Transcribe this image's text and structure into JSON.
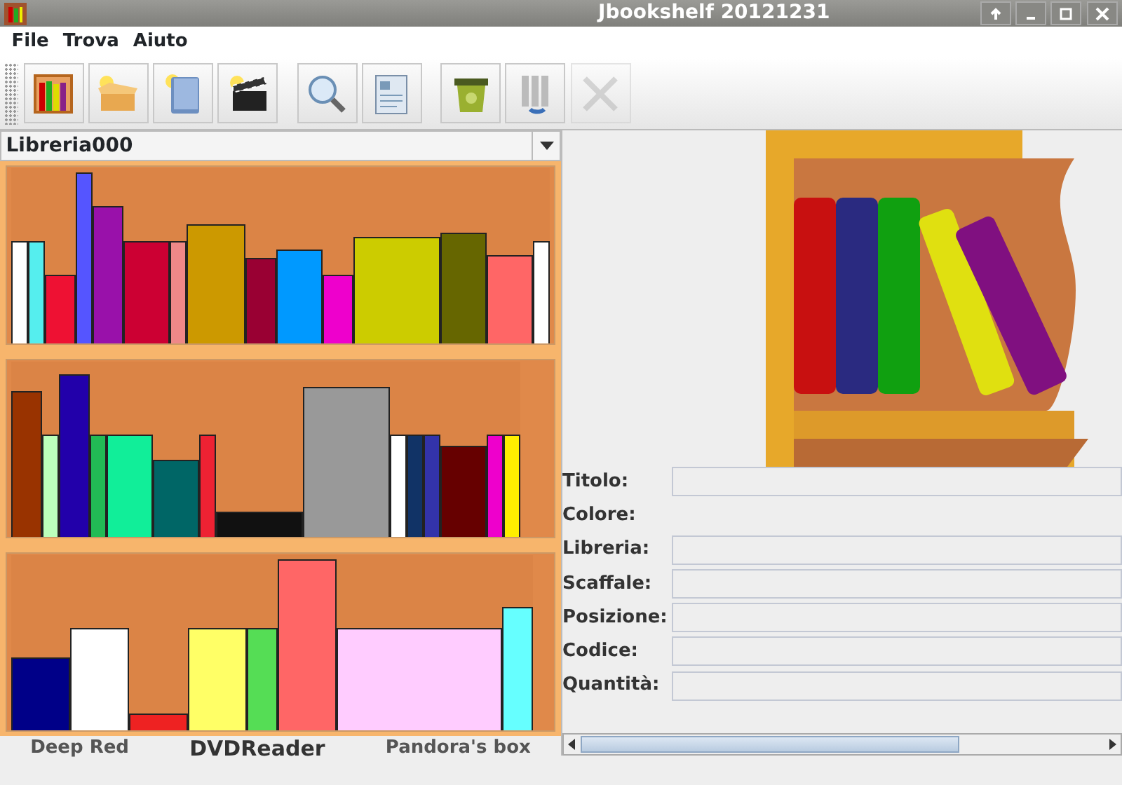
{
  "window": {
    "title": "Jbookshelf 20121231"
  },
  "menu": [
    "File",
    "Trova",
    "Aiuto"
  ],
  "toolbar": [
    {
      "kind": "library",
      "disabled": false
    },
    {
      "kind": "box",
      "disabled": false
    },
    {
      "kind": "book",
      "disabled": false
    },
    {
      "kind": "clapper",
      "disabled": false
    },
    {
      "kind": "search",
      "disabled": false
    },
    {
      "kind": "document",
      "disabled": false
    },
    {
      "kind": "bin",
      "disabled": false
    },
    {
      "kind": "move",
      "disabled": false
    },
    {
      "kind": "delete",
      "disabled": true
    }
  ],
  "library_select": {
    "value": "Libreria000"
  },
  "shelves": [
    {
      "books": [
        {
          "color": "#ffffff",
          "level": 0.6,
          "kind": "slim"
        },
        {
          "color": "#55eeee",
          "level": 0.6,
          "kind": "slim"
        },
        {
          "color": "#ee1133",
          "level": 0.4,
          "kind": "thin"
        },
        {
          "color": "#5555ff",
          "level": 1,
          "kind": "slim"
        },
        {
          "color": "#9911aa",
          "level": 0.8,
          "kind": "thin"
        },
        {
          "color": "#cc0033",
          "level": 0.6,
          "kind": "medium"
        },
        {
          "color": "#ee8888",
          "level": 0.6,
          "kind": "slim"
        },
        {
          "color": "#cc9900",
          "level": 0.7,
          "kind": "wide"
        },
        {
          "color": "#990033",
          "level": 0.5,
          "kind": "thin"
        },
        {
          "color": "#0099ff",
          "level": 0.55,
          "kind": "medium"
        },
        {
          "color": "#ee00cc",
          "level": 0.4,
          "kind": "thin"
        },
        {
          "color": "#cccc00",
          "level": 0.62,
          "kind": "broad"
        },
        {
          "color": "#666600",
          "level": 0.65,
          "kind": "medium"
        },
        {
          "color": "#ff6666",
          "level": 0.52,
          "kind": "medium"
        },
        {
          "color": "#ffffff",
          "level": 0.6,
          "kind": "slim"
        }
      ]
    },
    {
      "books": [
        {
          "color": "#993300",
          "level": 0.85,
          "kind": "thin"
        },
        {
          "color": "#bbffbb",
          "level": 0.6,
          "kind": "slim"
        },
        {
          "color": "#2200aa",
          "level": 0.95,
          "kind": "thin"
        },
        {
          "color": "#22bb55",
          "level": 0.6,
          "kind": "slim"
        },
        {
          "color": "#11ee99",
          "level": 0.6,
          "kind": "medium"
        },
        {
          "color": "#006666",
          "level": 0.45,
          "kind": "medium"
        },
        {
          "color": "#ee2233",
          "level": 0.6,
          "kind": "slim"
        },
        {
          "color": "#111111",
          "level": 0.15,
          "kind": "broad"
        },
        {
          "color": "#999999",
          "level": 0.88,
          "kind": "broad"
        },
        {
          "color": "#ffffff",
          "level": 0.6,
          "kind": "slim"
        },
        {
          "color": "#113366",
          "level": 0.6,
          "kind": "slim"
        },
        {
          "color": "#3333aa",
          "level": 0.6,
          "kind": "slim"
        },
        {
          "color": "#660000",
          "level": 0.53,
          "kind": "medium"
        },
        {
          "color": "#ee00cc",
          "level": 0.6,
          "kind": "slim"
        },
        {
          "color": "#ffee00",
          "level": 0.6,
          "kind": "slim"
        }
      ]
    },
    {
      "books": [
        {
          "color": "#000088",
          "level": 0.43,
          "kind": "wide"
        },
        {
          "color": "#ffffff",
          "level": 0.6,
          "kind": "wide"
        },
        {
          "color": "#ee2222",
          "level": 0.1,
          "kind": "wide"
        },
        {
          "color": "#ffff66",
          "level": 0.6,
          "kind": "wide"
        },
        {
          "color": "#55dd55",
          "level": 0.6,
          "kind": "thin"
        },
        {
          "color": "#ff6666",
          "level": 1,
          "kind": "wide"
        },
        {
          "color": "#ffccff",
          "level": 0.6,
          "kind": "huge"
        },
        {
          "color": "#66ffff",
          "level": 0.72,
          "kind": "thin"
        }
      ]
    }
  ],
  "status_items": [
    {
      "text": "Deep Red",
      "selected": false
    },
    {
      "text": "DVDReader",
      "selected": true
    },
    {
      "text": "Pandora's box",
      "selected": false
    }
  ],
  "details": [
    {
      "label": "Titolo:",
      "kind": "text"
    },
    {
      "label": "Colore:",
      "kind": "color"
    },
    {
      "label": "Libreria:",
      "kind": "text"
    },
    {
      "label": "Scaffale:",
      "kind": "text"
    },
    {
      "label": "Posizione:",
      "kind": "text"
    },
    {
      "label": "Codice:",
      "kind": "text"
    },
    {
      "label": "Quantità:",
      "kind": "text"
    }
  ]
}
